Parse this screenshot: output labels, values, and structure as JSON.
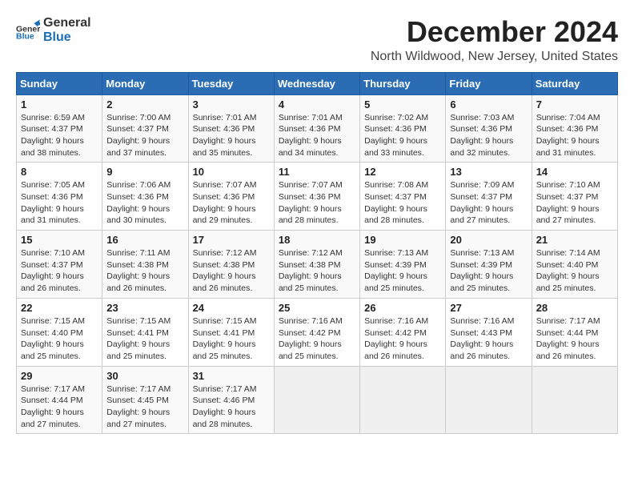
{
  "logo": {
    "text_general": "General",
    "text_blue": "Blue"
  },
  "header": {
    "month": "December 2024",
    "location": "North Wildwood, New Jersey, United States"
  },
  "weekdays": [
    "Sunday",
    "Monday",
    "Tuesday",
    "Wednesday",
    "Thursday",
    "Friday",
    "Saturday"
  ],
  "weeks": [
    [
      {
        "day": "1",
        "sunrise": "6:59 AM",
        "sunset": "4:37 PM",
        "daylight": "9 hours and 38 minutes."
      },
      {
        "day": "2",
        "sunrise": "7:00 AM",
        "sunset": "4:37 PM",
        "daylight": "9 hours and 37 minutes."
      },
      {
        "day": "3",
        "sunrise": "7:01 AM",
        "sunset": "4:36 PM",
        "daylight": "9 hours and 35 minutes."
      },
      {
        "day": "4",
        "sunrise": "7:01 AM",
        "sunset": "4:36 PM",
        "daylight": "9 hours and 34 minutes."
      },
      {
        "day": "5",
        "sunrise": "7:02 AM",
        "sunset": "4:36 PM",
        "daylight": "9 hours and 33 minutes."
      },
      {
        "day": "6",
        "sunrise": "7:03 AM",
        "sunset": "4:36 PM",
        "daylight": "9 hours and 32 minutes."
      },
      {
        "day": "7",
        "sunrise": "7:04 AM",
        "sunset": "4:36 PM",
        "daylight": "9 hours and 31 minutes."
      }
    ],
    [
      {
        "day": "8",
        "sunrise": "7:05 AM",
        "sunset": "4:36 PM",
        "daylight": "9 hours and 31 minutes."
      },
      {
        "day": "9",
        "sunrise": "7:06 AM",
        "sunset": "4:36 PM",
        "daylight": "9 hours and 30 minutes."
      },
      {
        "day": "10",
        "sunrise": "7:07 AM",
        "sunset": "4:36 PM",
        "daylight": "9 hours and 29 minutes."
      },
      {
        "day": "11",
        "sunrise": "7:07 AM",
        "sunset": "4:36 PM",
        "daylight": "9 hours and 28 minutes."
      },
      {
        "day": "12",
        "sunrise": "7:08 AM",
        "sunset": "4:37 PM",
        "daylight": "9 hours and 28 minutes."
      },
      {
        "day": "13",
        "sunrise": "7:09 AM",
        "sunset": "4:37 PM",
        "daylight": "9 hours and 27 minutes."
      },
      {
        "day": "14",
        "sunrise": "7:10 AM",
        "sunset": "4:37 PM",
        "daylight": "9 hours and 27 minutes."
      }
    ],
    [
      {
        "day": "15",
        "sunrise": "7:10 AM",
        "sunset": "4:37 PM",
        "daylight": "9 hours and 26 minutes."
      },
      {
        "day": "16",
        "sunrise": "7:11 AM",
        "sunset": "4:38 PM",
        "daylight": "9 hours and 26 minutes."
      },
      {
        "day": "17",
        "sunrise": "7:12 AM",
        "sunset": "4:38 PM",
        "daylight": "9 hours and 26 minutes."
      },
      {
        "day": "18",
        "sunrise": "7:12 AM",
        "sunset": "4:38 PM",
        "daylight": "9 hours and 25 minutes."
      },
      {
        "day": "19",
        "sunrise": "7:13 AM",
        "sunset": "4:39 PM",
        "daylight": "9 hours and 25 minutes."
      },
      {
        "day": "20",
        "sunrise": "7:13 AM",
        "sunset": "4:39 PM",
        "daylight": "9 hours and 25 minutes."
      },
      {
        "day": "21",
        "sunrise": "7:14 AM",
        "sunset": "4:40 PM",
        "daylight": "9 hours and 25 minutes."
      }
    ],
    [
      {
        "day": "22",
        "sunrise": "7:15 AM",
        "sunset": "4:40 PM",
        "daylight": "9 hours and 25 minutes."
      },
      {
        "day": "23",
        "sunrise": "7:15 AM",
        "sunset": "4:41 PM",
        "daylight": "9 hours and 25 minutes."
      },
      {
        "day": "24",
        "sunrise": "7:15 AM",
        "sunset": "4:41 PM",
        "daylight": "9 hours and 25 minutes."
      },
      {
        "day": "25",
        "sunrise": "7:16 AM",
        "sunset": "4:42 PM",
        "daylight": "9 hours and 25 minutes."
      },
      {
        "day": "26",
        "sunrise": "7:16 AM",
        "sunset": "4:42 PM",
        "daylight": "9 hours and 26 minutes."
      },
      {
        "day": "27",
        "sunrise": "7:16 AM",
        "sunset": "4:43 PM",
        "daylight": "9 hours and 26 minutes."
      },
      {
        "day": "28",
        "sunrise": "7:17 AM",
        "sunset": "4:44 PM",
        "daylight": "9 hours and 26 minutes."
      }
    ],
    [
      {
        "day": "29",
        "sunrise": "7:17 AM",
        "sunset": "4:44 PM",
        "daylight": "9 hours and 27 minutes."
      },
      {
        "day": "30",
        "sunrise": "7:17 AM",
        "sunset": "4:45 PM",
        "daylight": "9 hours and 27 minutes."
      },
      {
        "day": "31",
        "sunrise": "7:17 AM",
        "sunset": "4:46 PM",
        "daylight": "9 hours and 28 minutes."
      },
      null,
      null,
      null,
      null
    ]
  ],
  "labels": {
    "sunrise": "Sunrise:",
    "sunset": "Sunset:",
    "daylight": "Daylight:"
  }
}
